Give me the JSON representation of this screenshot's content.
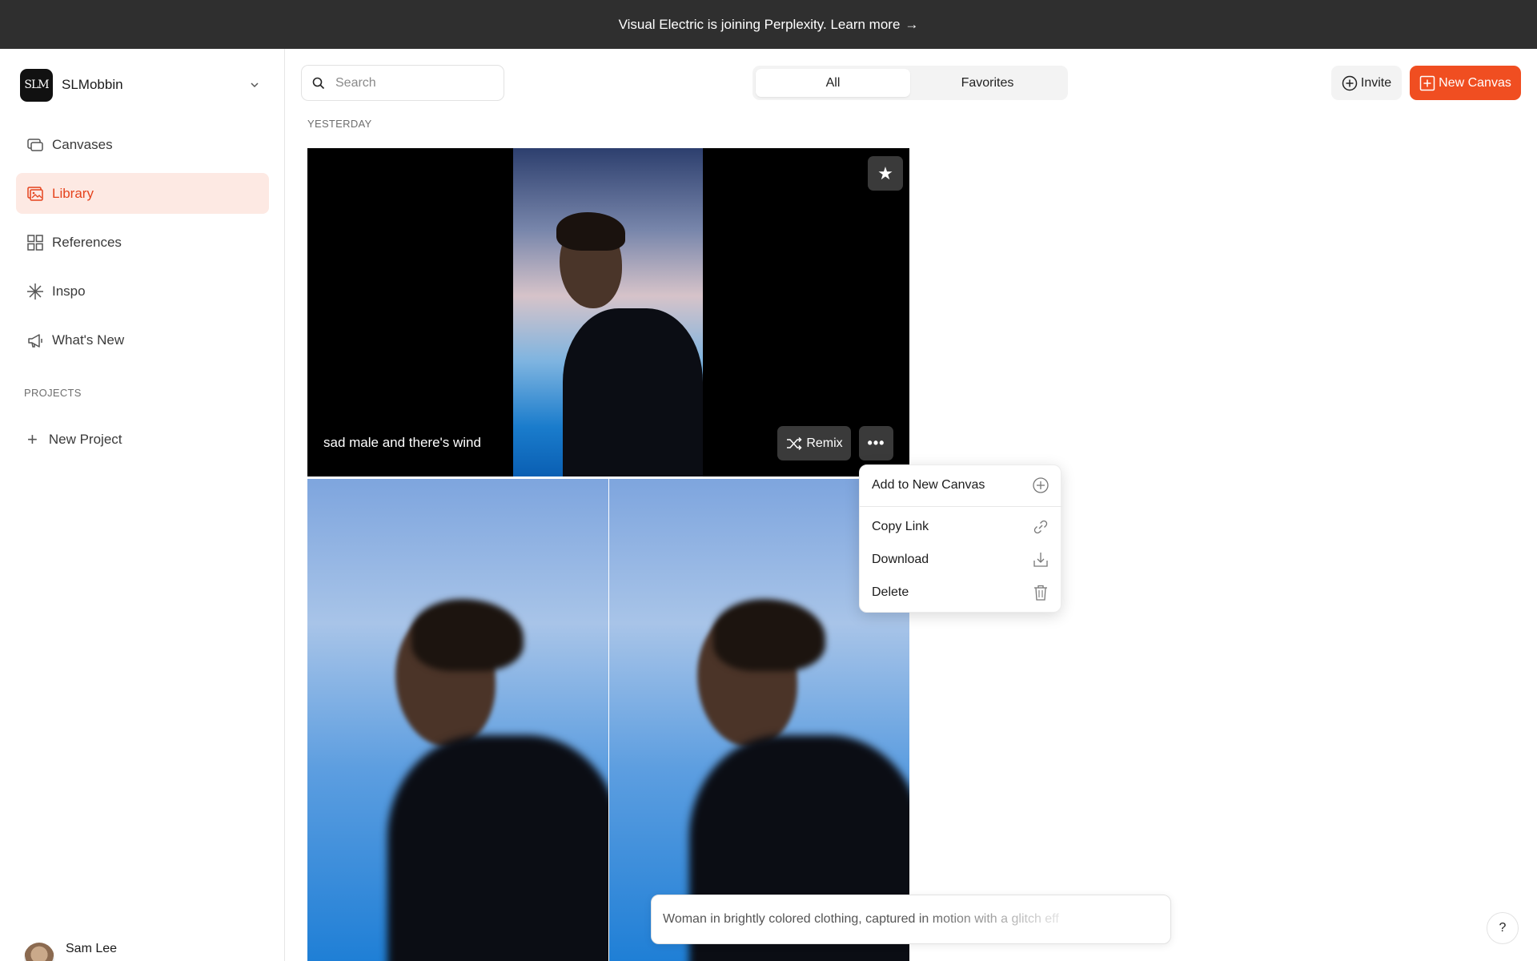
{
  "banner": {
    "text": "Visual Electric is joining Perplexity. Learn more",
    "arrow": "→"
  },
  "workspace": {
    "logo_text": "SLM",
    "name": "SLMobbin",
    "chevron_icon": "chevron-down-icon"
  },
  "sidebar": {
    "items": [
      {
        "label": "Canvases",
        "icon": "canvases-icon",
        "active": false
      },
      {
        "label": "Library",
        "icon": "library-icon",
        "active": true
      },
      {
        "label": "References",
        "icon": "grid-icon",
        "active": false
      },
      {
        "label": "Inspo",
        "icon": "sparkle-icon",
        "active": false
      },
      {
        "label": "What's New",
        "icon": "megaphone-icon",
        "active": false
      }
    ],
    "projects_label": "PROJECTS",
    "new_project_label": "New Project",
    "user_name": "Sam Lee"
  },
  "toolbar": {
    "search_placeholder": "Search",
    "tabs": [
      {
        "label": "All",
        "active": true
      },
      {
        "label": "Favorites",
        "active": false
      }
    ],
    "invite_label": "Invite",
    "new_canvas_label": "New Canvas"
  },
  "library": {
    "day_label": "YESTERDAY",
    "items": [
      {
        "caption": "sad male and there's wind",
        "remix_label": "Remix",
        "more_label": "•••",
        "star_glyph": "★"
      }
    ]
  },
  "context_menu": {
    "items": [
      {
        "label": "Add to New Canvas",
        "icon": "plus-circle-icon"
      },
      {
        "label": "Copy Link",
        "icon": "link-icon"
      },
      {
        "label": "Download",
        "icon": "download-icon"
      },
      {
        "label": "Delete",
        "icon": "trash-icon"
      }
    ]
  },
  "prompt_bar": {
    "text": "Woman in brightly colored clothing, captured in motion with a glitch eff"
  },
  "help_label": "?",
  "colors": {
    "accent": "#f04e21",
    "active_bg": "#fde9e3",
    "active_text": "#e5431d",
    "banner_bg": "#2f2f2f"
  }
}
